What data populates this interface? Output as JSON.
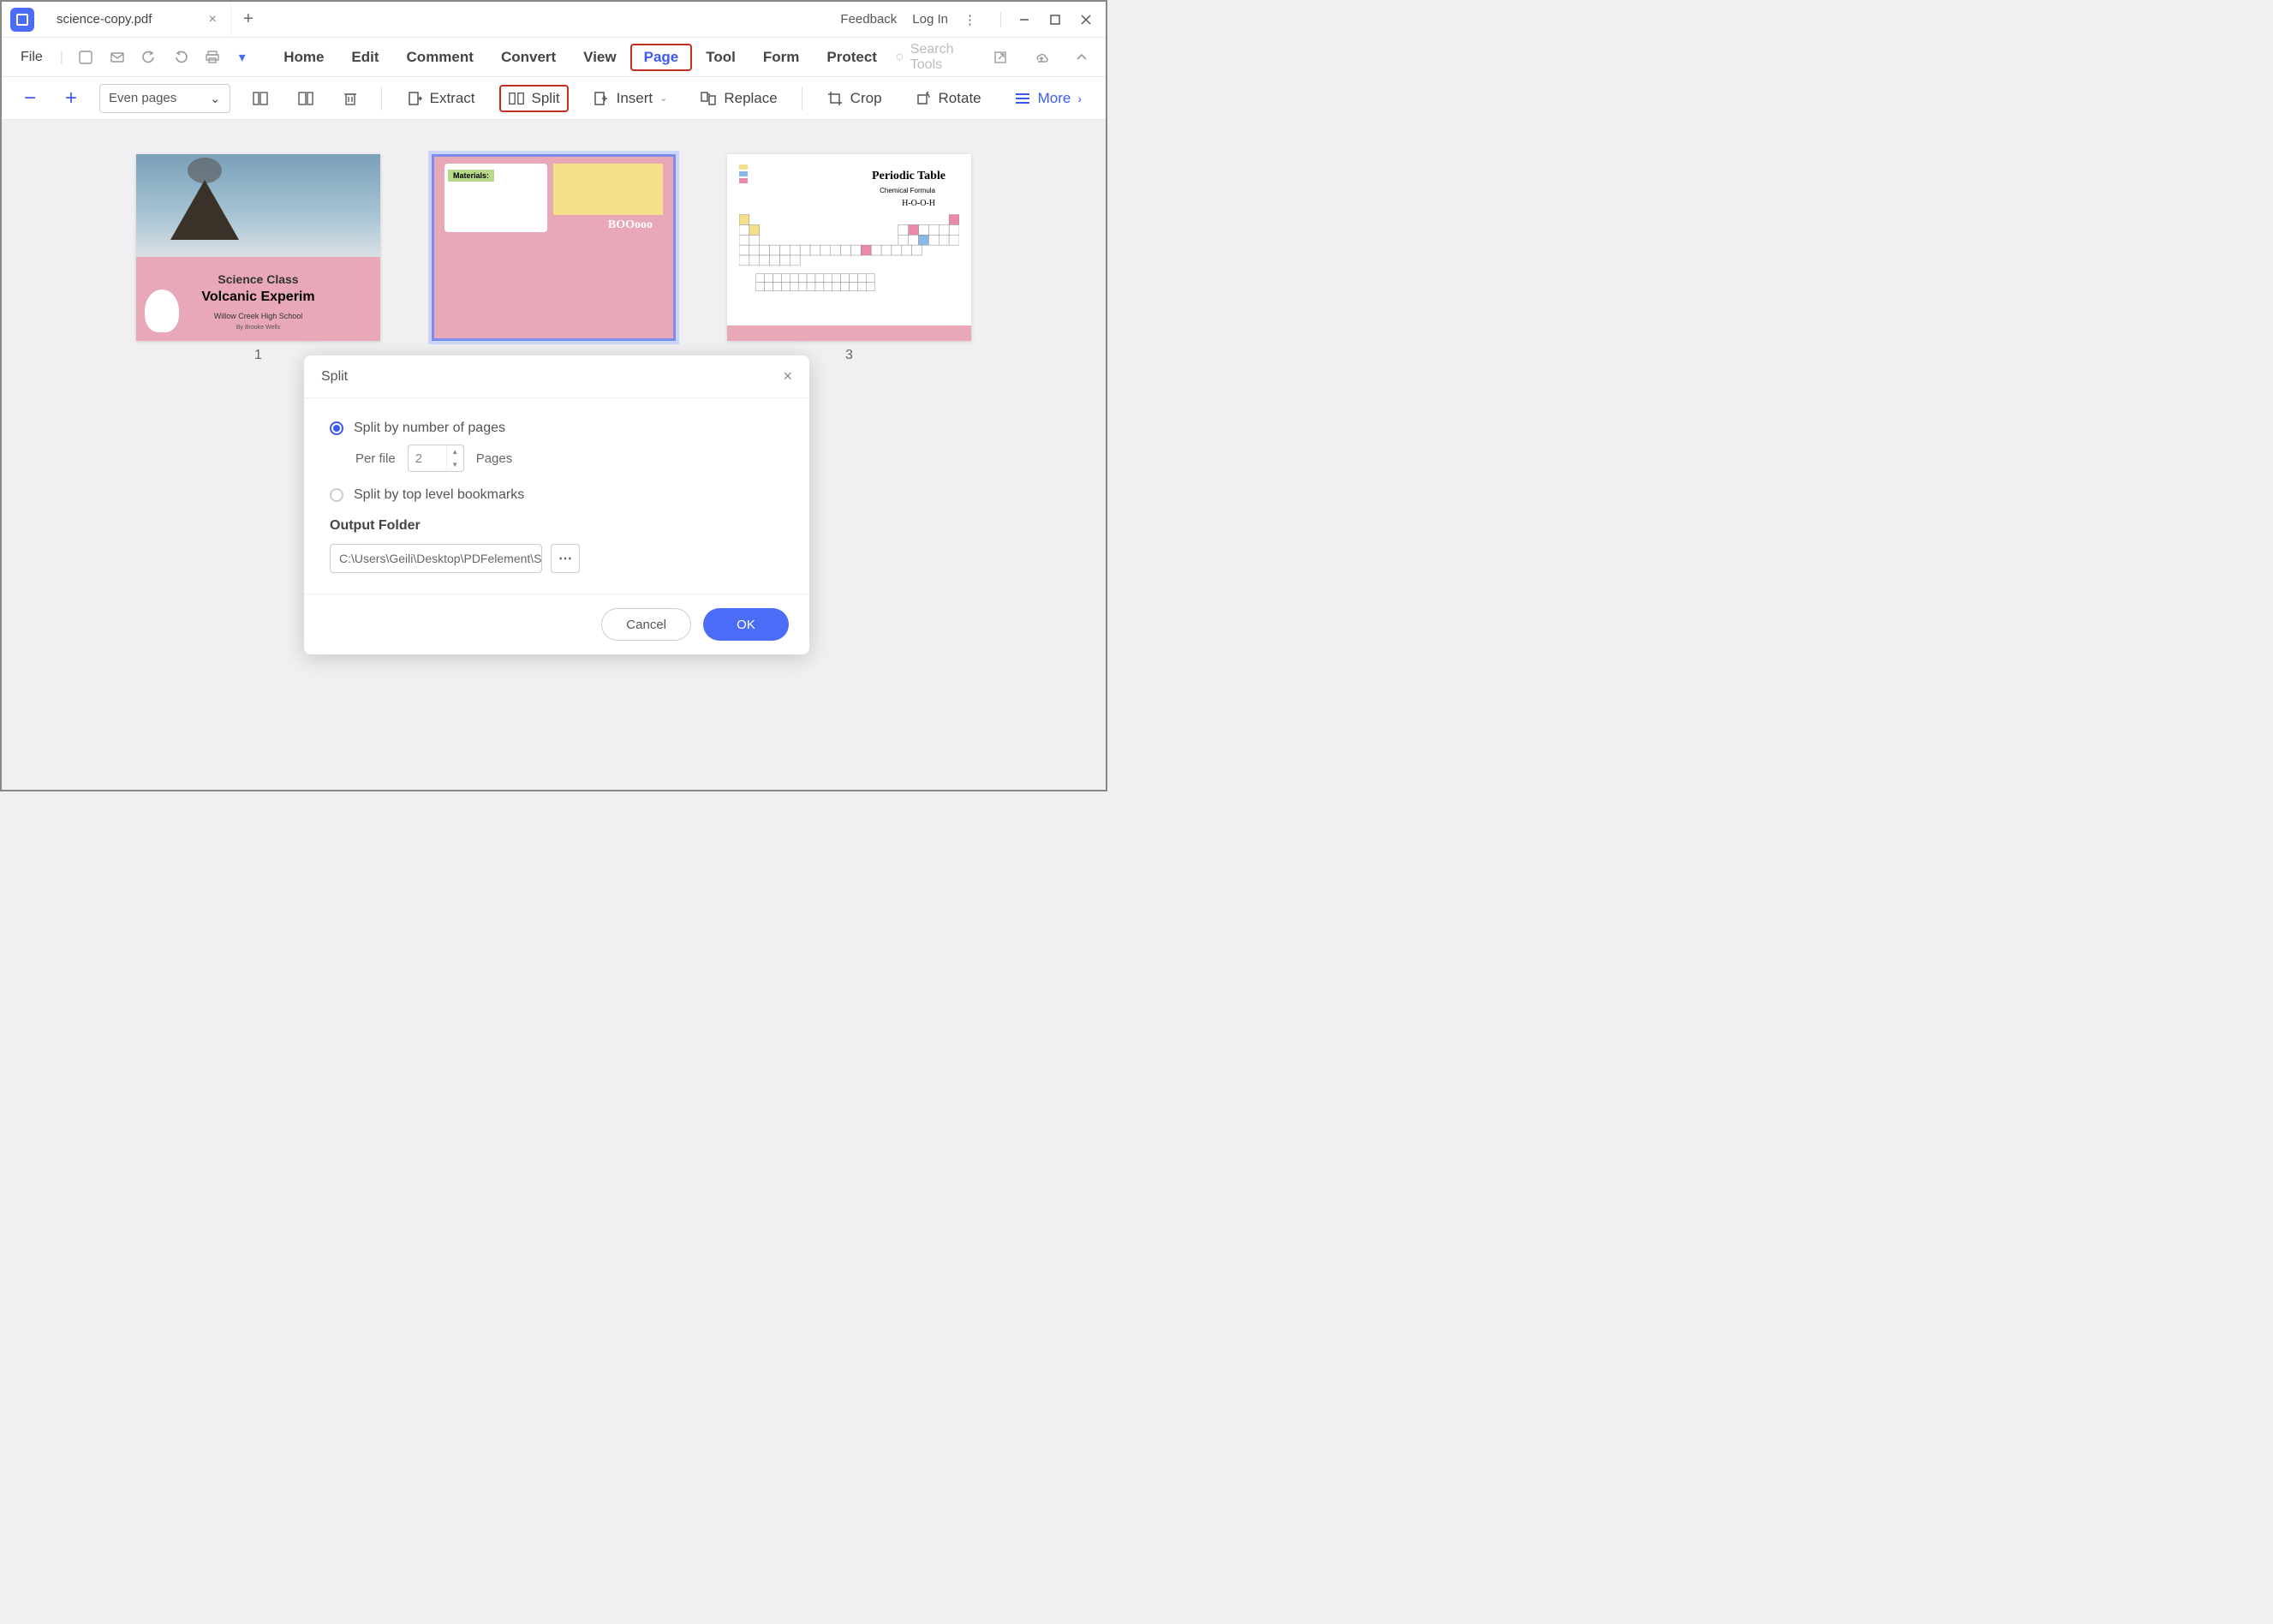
{
  "titlebar": {
    "tab_title": "science-copy.pdf",
    "feedback": "Feedback",
    "login": "Log In"
  },
  "menubar": {
    "file": "File",
    "items": [
      "Home",
      "Edit",
      "Comment",
      "Convert",
      "View",
      "Page",
      "Tool",
      "Form",
      "Protect"
    ],
    "active_index": 5,
    "search_placeholder": "Search Tools"
  },
  "toolbar": {
    "page_filter": "Even pages",
    "extract": "Extract",
    "split": "Split",
    "insert": "Insert",
    "replace": "Replace",
    "crop": "Crop",
    "rotate": "Rotate",
    "more": "More"
  },
  "pages": {
    "labels": [
      "1",
      "",
      "3"
    ],
    "selected_index": 1,
    "thumb1": {
      "line1": "Science Class",
      "line2": "Volcanic Experim",
      "line3": "Willow Creek High School",
      "line4": "By Brooke Wells"
    },
    "thumb2": {
      "materials": "Materials:",
      "boo": "BOOooo"
    },
    "thumb3": {
      "title": "Periodic Table",
      "sub": "Chemical Formula",
      "formula": "H-O-O-H"
    }
  },
  "dialog": {
    "title": "Split",
    "option_pages": "Split by number of pages",
    "option_bookmarks": "Split by top level bookmarks",
    "per_file_label": "Per file",
    "per_file_value": "2",
    "pages_label": "Pages",
    "output_folder_label": "Output Folder",
    "output_path": "C:\\Users\\Geili\\Desktop\\PDFelement\\Sp",
    "cancel": "Cancel",
    "ok": "OK"
  }
}
